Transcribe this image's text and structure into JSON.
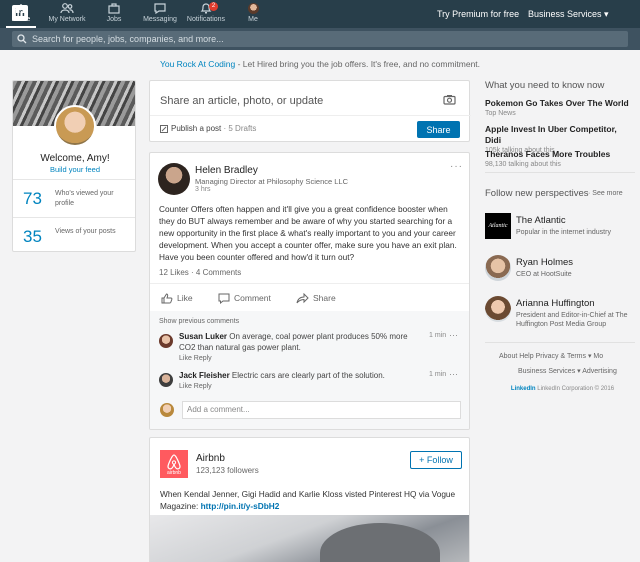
{
  "topnav": {
    "logo": "in",
    "items": [
      {
        "label": "Home",
        "icon": "home-icon"
      },
      {
        "label": "My Network",
        "icon": "network-icon"
      },
      {
        "label": "Jobs",
        "icon": "briefcase-icon"
      },
      {
        "label": "Messaging",
        "icon": "chat-icon"
      },
      {
        "label": "Notifications",
        "icon": "bell-icon",
        "badge": "2"
      },
      {
        "label": "Me",
        "icon": "avatar-icon"
      }
    ],
    "premium": "Try Premium for free",
    "business": "Business Services ▾"
  },
  "search": {
    "placeholder": "Search for people, jobs, companies, and more..."
  },
  "promo": {
    "highlight": "You Rock At Coding",
    "text": " - Let Hired bring you the job offers. It's free, and no commitment."
  },
  "profile": {
    "welcome": "Welcome, Amy!",
    "build": "Build your feed",
    "stats": [
      {
        "value": "73",
        "label": "Who's viewed your profile"
      },
      {
        "value": "35",
        "label": "Views of your posts"
      }
    ]
  },
  "share": {
    "prompt": "Share an article, photo, or update",
    "publish": "Publish a post",
    "drafts": " · 5 Drafts",
    "button": "Share"
  },
  "post": {
    "author": "Helen Bradley",
    "title": "Managing Director at Philosophy Science LLC",
    "time": "3 hrs",
    "body": "Counter Offers often happen and it'll give you a great confidence booster when they do BUT always remember and be aware of why you started searching for a new opportunity in the first place & what's really important to you and your career development. When you accept a counter offer, make sure you have an exit plan. Have you been counter offered and how'd it turn out?",
    "counts": "12 Likes · 4 Comments",
    "actions": {
      "like": "Like",
      "comment": "Comment",
      "share": "Share"
    },
    "show_previous": "Show previous comments",
    "comments": [
      {
        "name": "Susan Luker",
        "text": " On average, coal power plant produces 50% more CO2 than natural gas power plant.",
        "time": "1 min",
        "links": "Like   Reply"
      },
      {
        "name": "Jack Fleisher",
        "text": " Electric cars are clearly part of the solution.",
        "time": "1 min",
        "links": "Like   Reply"
      }
    ],
    "add_comment_placeholder": "Add a comment..."
  },
  "airbnb": {
    "name": "Airbnb",
    "followers": "123,123 followers",
    "follow": "+ Follow",
    "logo_text": "airbnb",
    "text": "When Kendal Jenner, Gigi Hadid and Karlie Kloss visted Pinterest HQ via Vogue Magazine: ",
    "link": "http://pin.it/y-sDbH2"
  },
  "right": {
    "need_title": "What you need to know now",
    "news": [
      {
        "title": "Pokemon Go Takes Over The World",
        "sub": "Top News"
      },
      {
        "title": "Apple Invest In Uber Competitor, Didi",
        "sub": "105k talking about this"
      },
      {
        "title": "Theranos Faces More Troubles",
        "sub": "98,130 talking about this"
      }
    ],
    "persp_title": "Follow new perspectives",
    "see_more": "· See more",
    "people": [
      {
        "name": "The Atlantic",
        "desc": "Popular in the internet industry",
        "logo": "Atlantic"
      },
      {
        "name": "Ryan Holmes",
        "desc": "CEO at HootSuite"
      },
      {
        "name": "Arianna Huffington",
        "desc": "President and Editor-in-Chief at The Huffington Post Media Group"
      }
    ],
    "footer_row1": "About     Help     Privacy & Terms ▾     Mo",
    "footer_row2": "Business Services ▾     Advertising",
    "footer_brand": "LinkedIn",
    "footer_copy": " LinkedIn Corporation © 2016"
  }
}
